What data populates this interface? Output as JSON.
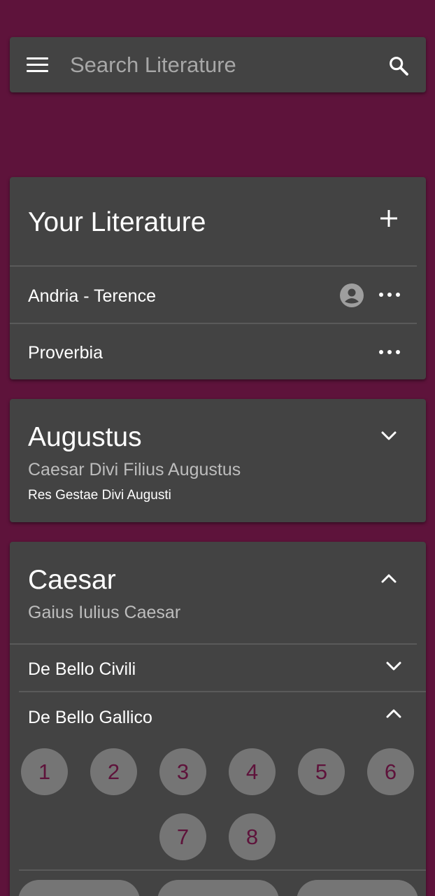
{
  "search": {
    "placeholder": "Search Literature"
  },
  "your_literature": {
    "title": "Your Literature",
    "items": [
      {
        "label": "Andria - Terence",
        "shared": true
      },
      {
        "label": "Proverbia",
        "shared": false
      }
    ]
  },
  "authors": [
    {
      "name": "Augustus",
      "full_name": "Caesar Divi Filius Augustus",
      "expanded": false,
      "works": [
        "Res Gestae Divi Augusti"
      ]
    },
    {
      "name": "Caesar",
      "full_name": "Gaius Iulius Caesar",
      "expanded": true,
      "works": [
        {
          "title": "De Bello Civili",
          "expanded": false
        },
        {
          "title": "De Bello Gallico",
          "expanded": true,
          "books": [
            "1",
            "2",
            "3",
            "4",
            "5",
            "6",
            "7",
            "8"
          ]
        }
      ]
    }
  ],
  "colors": {
    "background": "#5e133b",
    "card": "#434343",
    "circle": "#757575",
    "accent_text": "#5e133b"
  }
}
